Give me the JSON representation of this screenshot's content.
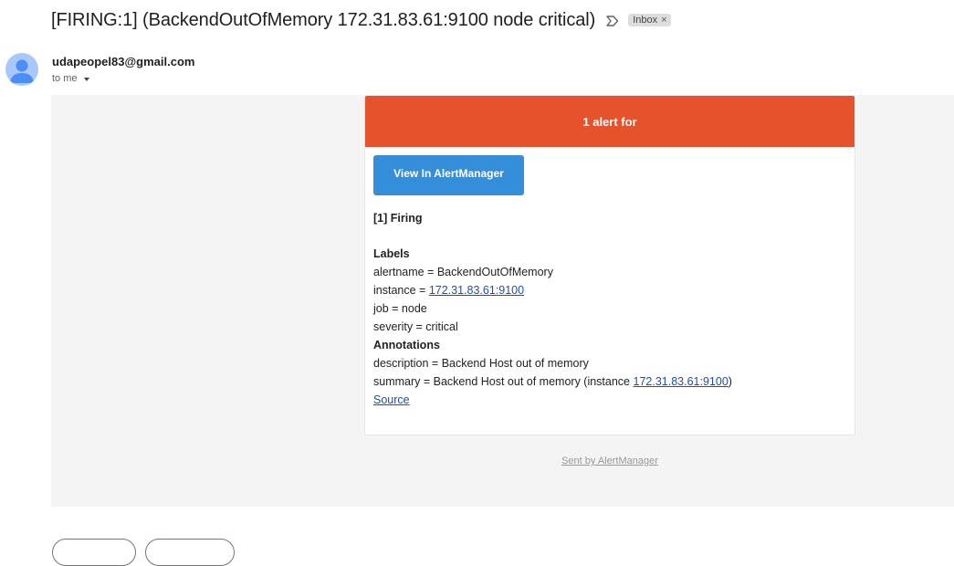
{
  "email": {
    "subject": "[FIRING:1] (BackendOutOfMemory 172.31.83.61:9100 node critical)",
    "label_chip": "Inbox",
    "label_chip_close": "×",
    "sender": "udapeopel83@gmail.com",
    "recipient_line": "to me"
  },
  "alert_card": {
    "header": "1 alert for",
    "button_label": "View In AlertManager",
    "firing_title": "[1] Firing",
    "labels_title": "Labels",
    "labels": {
      "alertname": "alertname = BackendOutOfMemory",
      "instance_prefix": "instance = ",
      "instance_link": "172.31.83.61:9100",
      "job": "job = node",
      "severity": "severity = critical"
    },
    "annotations_title": "Annotations",
    "annotations": {
      "description": "description = Backend Host out of memory",
      "summary_prefix": "summary = Backend Host out of memory (instance ",
      "summary_link": "172.31.83.61:9100",
      "summary_suffix": ")"
    },
    "source_link": "Source"
  },
  "footer": {
    "sent_by": "Sent by AlertManager"
  },
  "colors": {
    "header_bg": "#e6522c",
    "button_bg": "#348eda",
    "link": "#1a4fb3",
    "body_bg": "#f4f4f4"
  }
}
